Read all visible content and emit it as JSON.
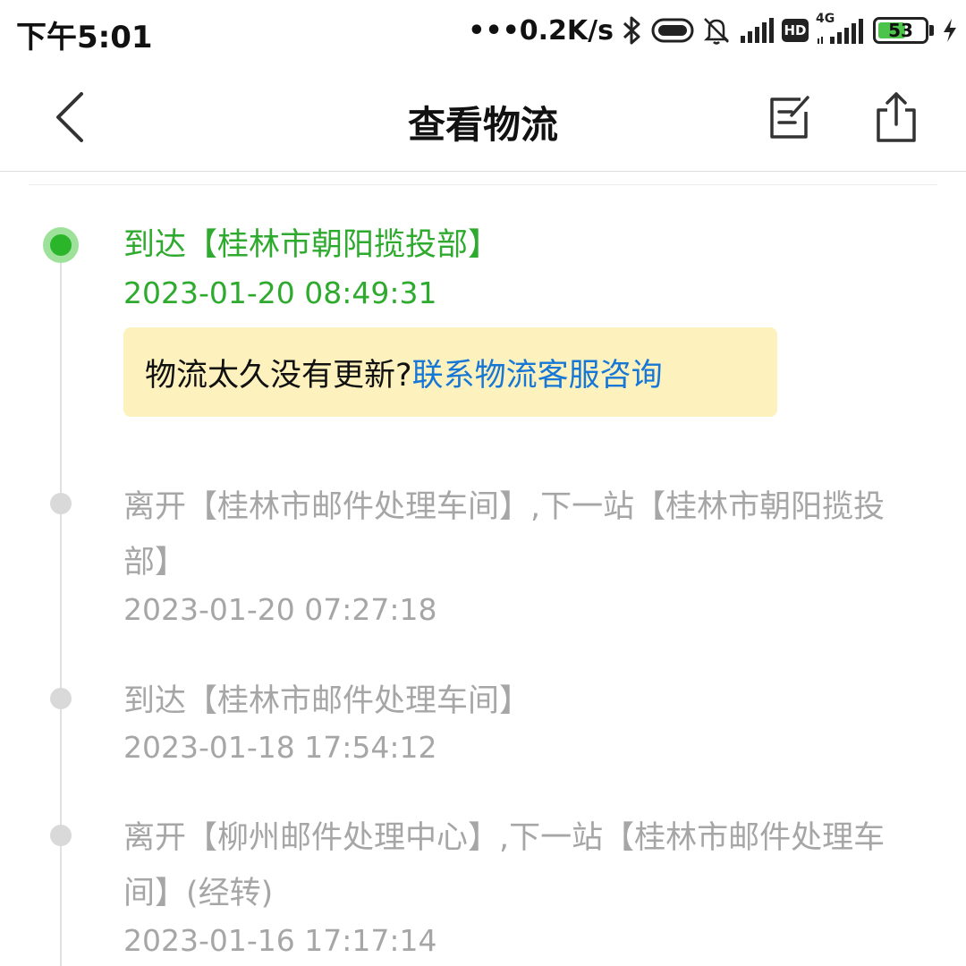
{
  "status_bar": {
    "time": "下午5:01",
    "net_speed": "•••0.2K/s",
    "network": "4G",
    "hd_badge": "HD",
    "battery": "53"
  },
  "header": {
    "title": "查看物流",
    "back_icon": "chevron-left-icon",
    "edit_icon": "edit-note-icon",
    "share_icon": "share-icon"
  },
  "events": [
    {
      "desc": "到达【桂林市朝阳揽投部】",
      "time": "2023-01-20 08:49:31",
      "active": true
    },
    {
      "desc": "离开【桂林市邮件处理车间】,下一站【桂林市朝阳揽投部】",
      "time": "2023-01-20 07:27:18",
      "active": false
    },
    {
      "desc": "到达【桂林市邮件处理车间】",
      "time": "2023-01-18 17:54:12",
      "active": false
    },
    {
      "desc": "离开【柳州邮件处理中心】,下一站【桂林市邮件处理车间】(经转)",
      "time": "2023-01-16 17:17:14",
      "active": false
    }
  ],
  "notice": {
    "question": "物流太久没有更新?",
    "link": "联系物流客服咨询"
  },
  "colors": {
    "active_green": "#2eaa2e",
    "link_blue": "#1677d6",
    "notice_bg": "#fdf2bd",
    "inactive_gray": "#a6a6a6"
  }
}
